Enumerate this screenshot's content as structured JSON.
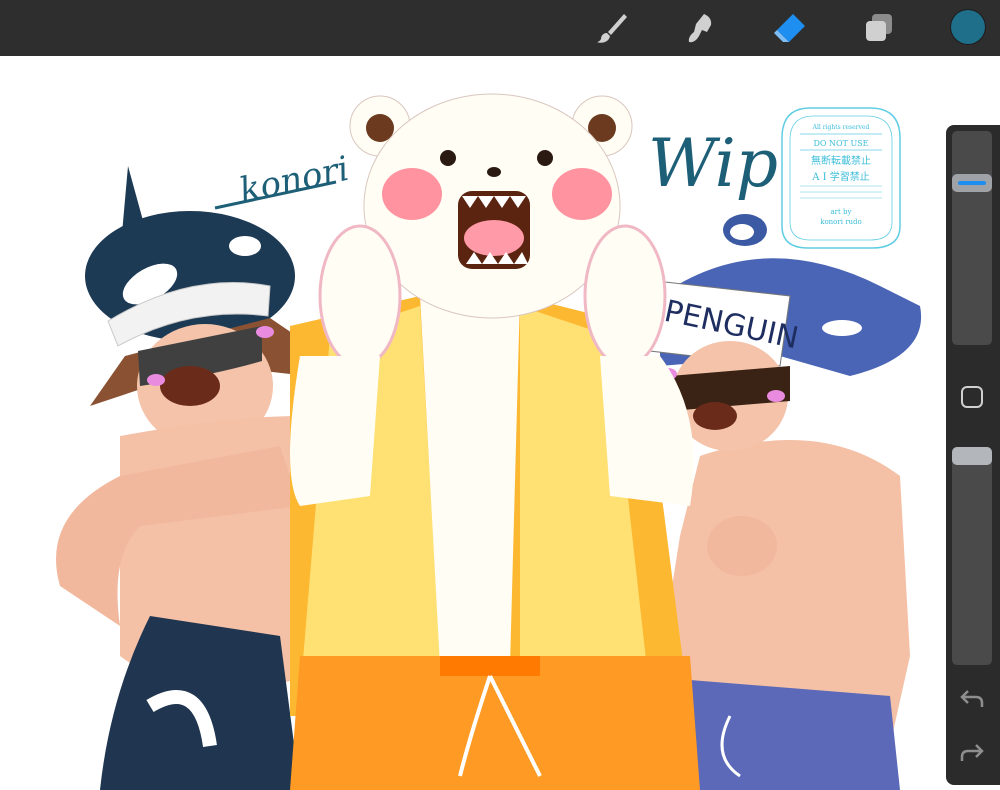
{
  "toolbar": {
    "tools": [
      {
        "name": "brush",
        "label": "Brush",
        "active": false
      },
      {
        "name": "smudge",
        "label": "Smudge",
        "active": false
      },
      {
        "name": "eraser",
        "label": "Eraser",
        "active": true
      },
      {
        "name": "layers",
        "label": "Layers",
        "active": false
      }
    ],
    "current_color": "#1f6f8b",
    "accent_color": "#1f8ef1",
    "icon_color": "#d0d0d0"
  },
  "sidebar": {
    "brush_size_level": 0.22,
    "opacity_level": 0.0,
    "modify_icon": "square-outline-icon",
    "undo_icon": "undo-arrow-icon",
    "redo_icon": "redo-arrow-icon"
  },
  "artwork": {
    "signature": "konori",
    "wip_text": "Wip",
    "hat_text": "PENGUIN",
    "watermark": {
      "line1": "All rights reserved",
      "line2": "DO NOT USE",
      "line3": "無断転載禁止",
      "line4": "A I 学習禁止",
      "line5": "art by",
      "line6": "konori rudo"
    }
  }
}
